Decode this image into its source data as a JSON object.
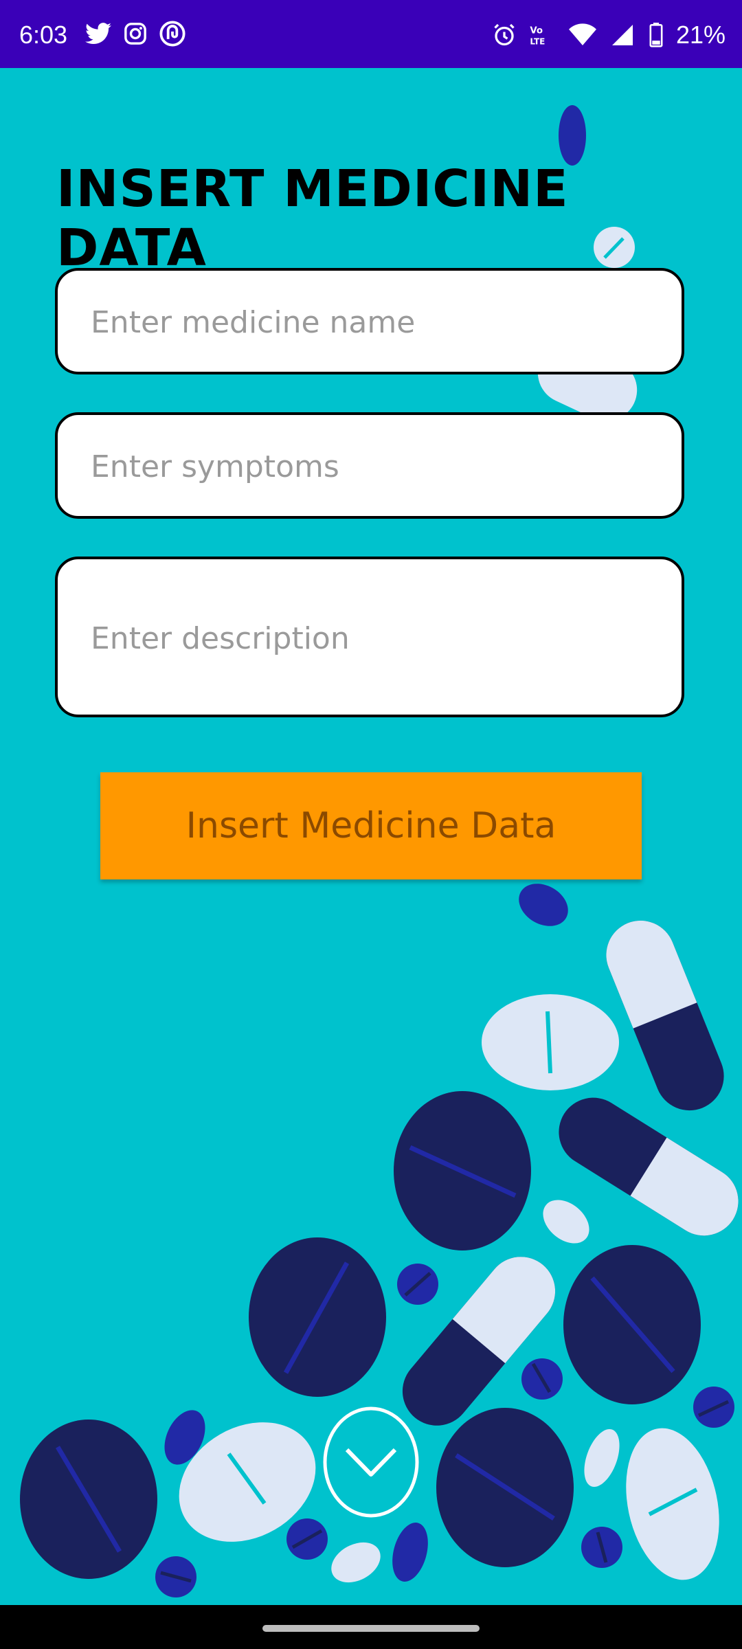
{
  "status": {
    "time": "6:03",
    "battery": "21%",
    "left_icons": [
      "twitter-icon",
      "instagram-icon",
      "app-icon"
    ],
    "right_icons": [
      "alarm-icon",
      "volte-icon",
      "wifi-icon",
      "signal-icon",
      "battery-icon"
    ]
  },
  "page": {
    "title": "INSERT MEDICINE DATA"
  },
  "form": {
    "name_placeholder": "Enter medicine name",
    "symptoms_placeholder": "Enter symptoms",
    "description_placeholder": "Enter description",
    "submit_label": "Insert Medicine Data"
  },
  "colors": {
    "background": "#00C2CD",
    "status_bar": "#3A00B8",
    "button": "#FF9800",
    "pill_dark": "#1A215C",
    "pill_light": "#DDE7F6",
    "pill_blue": "#2129A6"
  }
}
